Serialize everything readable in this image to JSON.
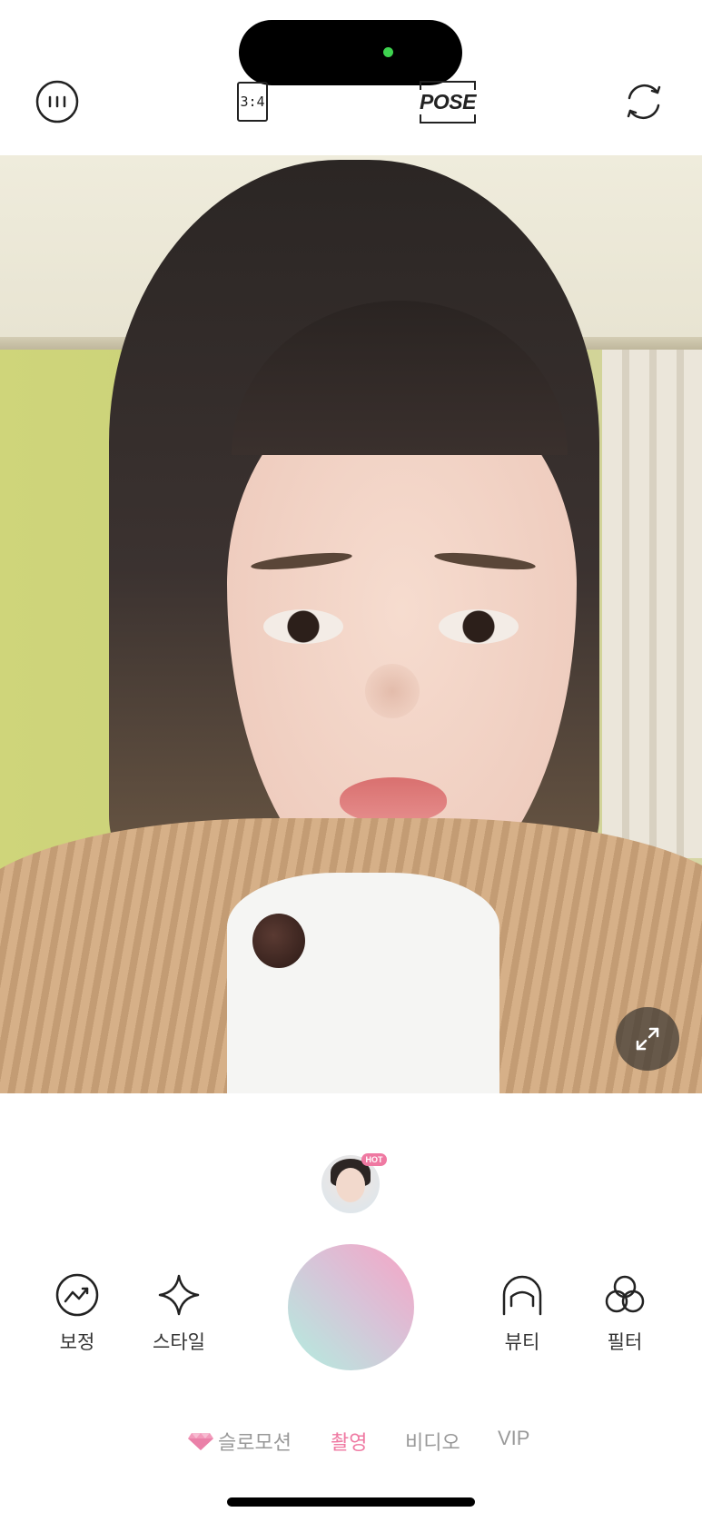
{
  "top_bar": {
    "menu_icon": "menu-icon",
    "ratio_label": "3:4",
    "pose_label": "POSE",
    "switch_icon": "camera-switch-icon"
  },
  "preview": {
    "expand_icon": "expand-icon"
  },
  "sticker": {
    "badge": "HOT"
  },
  "tools": {
    "edit": "보정",
    "style": "스타일",
    "beauty": "뷰티",
    "filter": "필터"
  },
  "modes": {
    "slowmo": "슬로모션",
    "photo": "촬영",
    "video": "비디오",
    "vip": "VIP",
    "active": "촬영"
  },
  "colors": {
    "accent": "#ef79a2",
    "shutter_start": "#f7a3c4",
    "shutter_end": "#b2eedf",
    "status_dot": "#3ed34f"
  }
}
